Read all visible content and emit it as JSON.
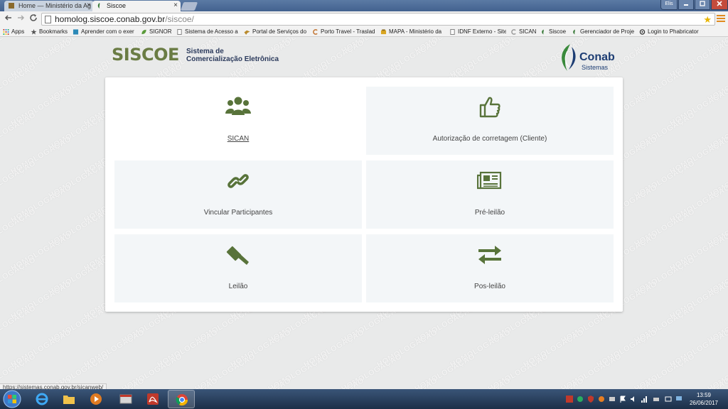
{
  "browser": {
    "tabs": [
      {
        "title": "Home — Ministério da Ag",
        "active": false
      },
      {
        "title": "Siscoe",
        "active": true
      }
    ],
    "close_glyph": "×",
    "user_label": "Elis",
    "url_host": "homolog.siscoe.conab.gov.br",
    "url_path": "/siscoe/",
    "status_url": "https://sistemas.conab.gov.br/sicanweb/"
  },
  "bookmarks": [
    {
      "label": "Apps",
      "icon": "apps-grid-icon"
    },
    {
      "label": "Bookmarks",
      "icon": "star-icon"
    },
    {
      "label": "Aprender com o exer",
      "icon": "square-icon"
    },
    {
      "label": "SIGNOR",
      "icon": "leaf-icon"
    },
    {
      "label": "Sistema de Acesso a I",
      "icon": "page-icon"
    },
    {
      "label": "Portal de Serviços do",
      "icon": "bird-icon"
    },
    {
      "label": "Porto Travel - Traslad",
      "icon": "c-icon"
    },
    {
      "label": "MAPA - Ministério da",
      "icon": "mapa-icon"
    },
    {
      "label": "IDNF Externo - Site",
      "icon": "page-icon"
    },
    {
      "label": "SICAN",
      "icon": "c-icon"
    },
    {
      "label": "Siscoe",
      "icon": "conab-icon"
    },
    {
      "label": "Gerenciador de Projet",
      "icon": "conab-icon"
    },
    {
      "label": "Login to Phabricator",
      "icon": "phab-icon"
    }
  ],
  "header": {
    "logo_text": "SISCOE",
    "subtitle_line1": "Sistema de",
    "subtitle_line2": "Comercialização Eletrônica",
    "partner_name": "Conab",
    "partner_sub": "Sistemas"
  },
  "watermark_text": "HOMOLOGAÇÃO",
  "tiles": [
    {
      "label": "SICAN",
      "icon": "users-group-icon",
      "link": true
    },
    {
      "label": "Autorização de corretagem (Cliente)",
      "icon": "thumbs-up-icon",
      "link": false
    },
    {
      "label": "Vincular Participantes",
      "icon": "chain-link-icon",
      "link": false
    },
    {
      "label": "Pré-leilão",
      "icon": "newspaper-icon",
      "link": false
    },
    {
      "label": "Leilão",
      "icon": "gavel-icon",
      "link": false
    },
    {
      "label": "Pos-leilão",
      "icon": "exchange-arrows-icon",
      "link": false
    }
  ],
  "colors": {
    "icon_green": "#58733a",
    "logo_green": "#6a7c44",
    "brand_navy": "#1d3d73"
  },
  "taskbar": {
    "apps": [
      "internet-explorer-icon",
      "folder-icon",
      "media-player-icon",
      "window-icon",
      "pdf-icon",
      "chrome-icon"
    ],
    "time": "13:59",
    "date": "26/06/2017"
  }
}
